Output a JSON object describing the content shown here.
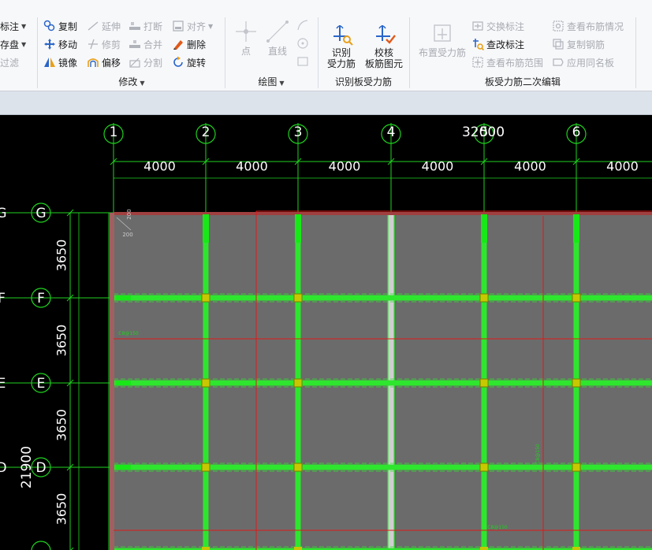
{
  "ribbon": {
    "left_partial": [
      {
        "label": "标注",
        "dropdown": true
      },
      {
        "label": "存盘",
        "dropdown": true
      },
      {
        "label": "过滤",
        "dropdown": false,
        "disabled": true
      }
    ],
    "modify": {
      "label": "修改",
      "items": [
        {
          "label": "复制",
          "icon": "copy-icon",
          "disabled": false
        },
        {
          "label": "延伸",
          "icon": "extend-icon",
          "disabled": true
        },
        {
          "label": "打断",
          "icon": "break-icon",
          "disabled": true
        },
        {
          "label": "对齐",
          "icon": "align-icon",
          "disabled": true,
          "dropdown": true
        },
        {
          "label": "移动",
          "icon": "move-icon",
          "disabled": false
        },
        {
          "label": "修剪",
          "icon": "trim-icon",
          "disabled": true
        },
        {
          "label": "合并",
          "icon": "merge-icon",
          "disabled": true
        },
        {
          "label": "删除",
          "icon": "delete-icon",
          "disabled": false
        },
        {
          "label": "镜像",
          "icon": "mirror-icon",
          "disabled": false
        },
        {
          "label": "偏移",
          "icon": "offset-icon",
          "disabled": false
        },
        {
          "label": "分割",
          "icon": "split-icon",
          "disabled": true
        },
        {
          "label": "旋转",
          "icon": "rotate-icon",
          "disabled": false
        }
      ]
    },
    "draw": {
      "label": "绘图",
      "point_label": "点",
      "line_label": "直线"
    },
    "identify": {
      "label": "识别板受力筋",
      "btn1_line1": "识别",
      "btn1_line2": "受力筋",
      "btn2_line1": "校核",
      "btn2_line2": "板筋图元"
    },
    "edit2": {
      "label": "板受力筋二次编辑",
      "place_label": "布置受力筋",
      "items": [
        {
          "label": "交换标注",
          "icon": "swap-label-icon",
          "disabled": true
        },
        {
          "label": "查看布筋情况",
          "icon": "view-rebar-icon",
          "disabled": true
        },
        {
          "label": "查改标注",
          "icon": "edit-label-icon",
          "disabled": false
        },
        {
          "label": "复制钢筋",
          "icon": "copy-rebar-icon",
          "disabled": true
        },
        {
          "label": "查看布筋范围",
          "icon": "view-range-icon",
          "disabled": true
        },
        {
          "label": "应用同名板",
          "icon": "apply-same-icon",
          "disabled": true
        }
      ]
    }
  },
  "drawing": {
    "col_axes": [
      "1",
      "2",
      "3",
      "4",
      "5",
      "6"
    ],
    "row_axes": [
      "G",
      "F",
      "E",
      "D"
    ],
    "col_spacings": [
      "4000",
      "4000",
      "4000",
      "4000",
      "4000",
      "4000"
    ],
    "total_width": "32000",
    "row_spacings": [
      "3650",
      "3650",
      "3650",
      "3650"
    ],
    "total_height": "21900",
    "small_dim_a": "200",
    "small_dim_b": "200",
    "rebar_tag_1": "C8@150",
    "rebar_tag_2": "C8@150",
    "rebar_tag_3": "C8@150",
    "colors": {
      "grid_green": "#1fd21f",
      "beam_green": "#2ee62e",
      "slab_fill": "#6b6b6b",
      "rebar_red": "#e01818",
      "column_yellow": "#c8c800"
    }
  }
}
